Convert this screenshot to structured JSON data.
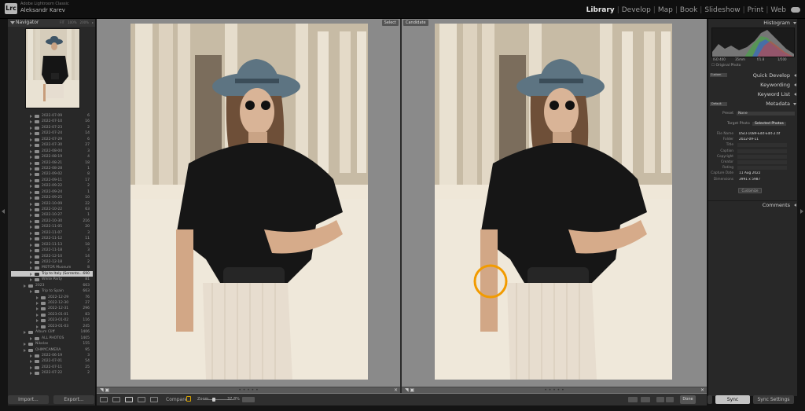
{
  "app": {
    "product": "Adobe Lightroom Classic",
    "user": "Aleksandr Karev",
    "logo": "Lrc"
  },
  "modules": [
    "Library",
    "Develop",
    "Map",
    "Book",
    "Slideshow",
    "Print",
    "Web"
  ],
  "active_module": "Library",
  "navigator": {
    "title": "Navigator",
    "zoom_options": [
      "FIT",
      "100%",
      "200%",
      "▸"
    ]
  },
  "folders": [
    {
      "name": "2022-07-09",
      "count": "6",
      "depth": 2
    },
    {
      "name": "2022-07-10",
      "count": "16",
      "depth": 2
    },
    {
      "name": "2022-07-23",
      "count": "2",
      "depth": 2
    },
    {
      "name": "2022-07-24",
      "count": "14",
      "depth": 2
    },
    {
      "name": "2022-07-29",
      "count": "6",
      "depth": 2
    },
    {
      "name": "2022-07-30",
      "count": "27",
      "depth": 2
    },
    {
      "name": "2022-08-04",
      "count": "3",
      "depth": 2
    },
    {
      "name": "2022-08-19",
      "count": "4",
      "depth": 2
    },
    {
      "name": "2022-08-21",
      "count": "18",
      "depth": 2
    },
    {
      "name": "2022-08-28",
      "count": "1",
      "depth": 2
    },
    {
      "name": "2022-09-02",
      "count": "8",
      "depth": 2
    },
    {
      "name": "2022-09-11",
      "count": "17",
      "depth": 2
    },
    {
      "name": "2022-09-22",
      "count": "2",
      "depth": 2
    },
    {
      "name": "2022-09-24",
      "count": "1",
      "depth": 2
    },
    {
      "name": "2022-09-25",
      "count": "10",
      "depth": 2
    },
    {
      "name": "2022-10-09",
      "count": "22",
      "depth": 2
    },
    {
      "name": "2022-10-22",
      "count": "63",
      "depth": 2
    },
    {
      "name": "2022-10-27",
      "count": "1",
      "depth": 2
    },
    {
      "name": "2022-10-30",
      "count": "216",
      "depth": 2
    },
    {
      "name": "2022-11-05",
      "count": "20",
      "depth": 2
    },
    {
      "name": "2022-11-07",
      "count": "3",
      "depth": 2
    },
    {
      "name": "2022-11-12",
      "count": "11",
      "depth": 2
    },
    {
      "name": "2022-11-13",
      "count": "18",
      "depth": 2
    },
    {
      "name": "2022-11-18",
      "count": "3",
      "depth": 2
    },
    {
      "name": "2022-12-10",
      "count": "14",
      "depth": 2
    },
    {
      "name": "2022-12-18",
      "count": "2",
      "depth": 2
    },
    {
      "name": "MOTOR Museum",
      "count": "8",
      "depth": 2
    },
    {
      "name": "Trip to Italy (Sorrento...",
      "count": "690",
      "depth": 2,
      "selected": true
    },
    {
      "name": "White Party",
      "count": "81",
      "depth": 2
    },
    {
      "name": "2023",
      "count": "663",
      "depth": 1
    },
    {
      "name": "Trip to Spain",
      "count": "663",
      "depth": 2
    },
    {
      "name": "2022-12-29",
      "count": "76",
      "depth": 3
    },
    {
      "name": "2022-12-30",
      "count": "27",
      "depth": 3
    },
    {
      "name": "2022-12-31",
      "count": "296",
      "depth": 3
    },
    {
      "name": "2023-01-01",
      "count": "83",
      "depth": 3
    },
    {
      "name": "2023-01-02",
      "count": "116",
      "depth": 3
    },
    {
      "name": "2023-01-03",
      "count": "245",
      "depth": 3
    },
    {
      "name": "Album Cliff",
      "count": "1406",
      "depth": 1
    },
    {
      "name": "ALL PHOTOS",
      "count": "1405",
      "depth": 2
    },
    {
      "name": "Nikolas",
      "count": "155",
      "depth": 1
    },
    {
      "name": "OHMYCAMERA",
      "count": "95",
      "depth": 1
    },
    {
      "name": "2022-06-19",
      "count": "3",
      "depth": 2
    },
    {
      "name": "2022-07-01",
      "count": "54",
      "depth": 2
    },
    {
      "name": "2022-07-11",
      "count": "25",
      "depth": 2
    },
    {
      "name": "2022-07-22",
      "count": "2",
      "depth": 2
    }
  ],
  "left_buttons": {
    "import": "Import...",
    "export": "Export..."
  },
  "compare": {
    "select_label": "Select",
    "candidate_label": "Candidate",
    "dots": "• • • • •",
    "close": "✕",
    "grip": "◥ ▣"
  },
  "toolbar": {
    "compare_label": "Compare",
    "zoom_label": "Zoom",
    "zoom_value": "37.8%",
    "done_label": "Done"
  },
  "right_panel": {
    "histogram": "Histogram",
    "histogram_info": [
      "ISO 400",
      "35mm",
      "f/1.8",
      "1/500"
    ],
    "original_photo": "Original Photo",
    "quick_develop": "Quick Develop",
    "keywording": "Keywording",
    "keyword_list": "Keyword List",
    "metadata": "Metadata",
    "saved_preset_select": "Custom",
    "metadata_select": "Default",
    "preset_label": "Preset",
    "preset_value": "None",
    "tab_target": "Target Photo",
    "tab_selected": "Selected Photos",
    "comments": "Comments",
    "customize": "Customize"
  },
  "metadata_fields": [
    {
      "label": "File Name",
      "value": "DSCF1089-Edit-Edit-2.tif",
      "kind": "plain"
    },
    {
      "label": "Folder",
      "value": "2022-09-11",
      "kind": "plain"
    },
    {
      "label": "Title",
      "value": "",
      "kind": "empty"
    },
    {
      "label": "Caption",
      "value": "",
      "kind": "empty"
    },
    {
      "label": "Copyright",
      "value": "",
      "kind": "empty"
    },
    {
      "label": "Creator",
      "value": "",
      "kind": "empty"
    },
    {
      "label": "Rating",
      "value": "",
      "kind": "empty"
    },
    {
      "label": "Capture Date",
      "value": "11 Aug 2022",
      "kind": "plain"
    },
    {
      "label": "Dimensions",
      "value": "3991 x 5987",
      "kind": "plain"
    }
  ],
  "right_buttons": {
    "sync": "Sync",
    "sync_settings": "Sync Settings"
  },
  "colors": {
    "accent_circle": "#f29b00",
    "sync_button": "#c4c4c4",
    "selected_folder": "#c9c9c9"
  }
}
